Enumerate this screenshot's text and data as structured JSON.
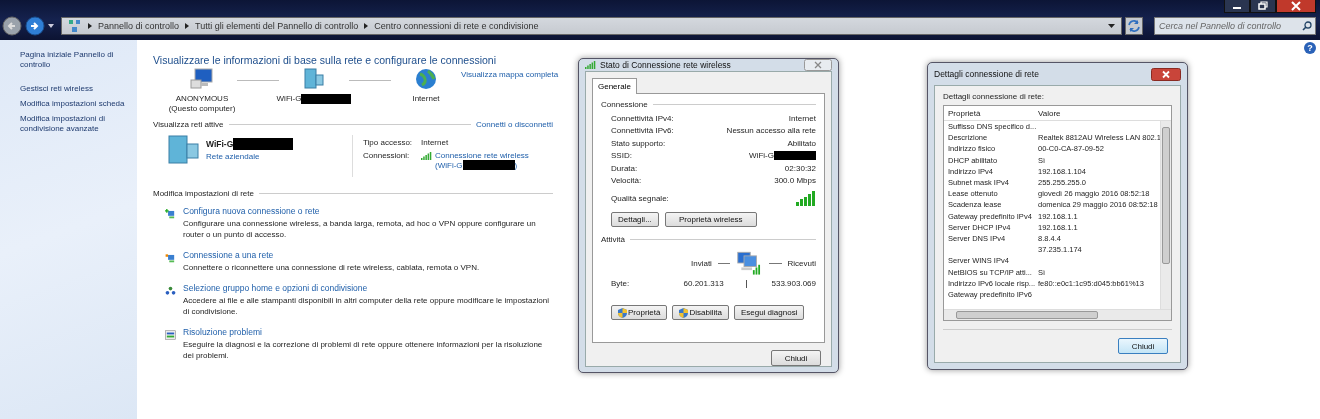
{
  "window": {
    "breadcrumb": [
      "Pannello di controllo",
      "Tutti gli elementi del Pannello di controllo",
      "Centro connessioni di rete e condivisione"
    ],
    "search": {
      "placeholder": "Cerca nel Pannello di controllo"
    },
    "help": "?"
  },
  "sidebar": {
    "items": [
      "Pagina iniziale Pannello di controllo",
      "Gestisci reti wireless",
      "Modifica impostazioni scheda",
      "Modifica impostazioni di condivisione avanzate"
    ]
  },
  "main": {
    "title": "Visualizzare le informazioni di base sulla rete e configurare le connessioni",
    "map_link": "Visualizza mappa completa",
    "map_nodes": [
      {
        "kind": "computer",
        "label": "ANONYMOUS",
        "sublabel": "(Questo computer)",
        "redacted": false
      },
      {
        "kind": "network",
        "label": "WiFi-G",
        "redacted": true
      },
      {
        "kind": "globe",
        "label": "Internet",
        "redacted": false
      }
    ],
    "active": {
      "heading": "Visualizza reti attive",
      "link": "Connetti o disconnetti",
      "name": "WiFi-G",
      "redacted": true,
      "type": "Rete aziendale",
      "access_label": "Tipo accesso:",
      "access_value": "Internet",
      "connections_label": "Connessioni:",
      "connection_link": "Connessione rete wireless",
      "connection_ssid": "(WiFi-G",
      "connection_ssid_end": ")"
    },
    "settings": {
      "heading": "Modifica impostazioni di rete",
      "tasks": [
        {
          "kind": "setup",
          "title": "Configura nuova connessione o rete",
          "description": "Configurare una connessione wireless, a banda larga, remota, ad hoc o VPN oppure configurare un router o un punto di accesso."
        },
        {
          "kind": "connect",
          "title": "Connessione a una rete",
          "description": "Connettere o riconnettere una connessione di rete wireless, cablata, remota o VPN."
        },
        {
          "kind": "homegroup",
          "title": "Selezione gruppo home e opzioni di condivisione",
          "description": "Accedere ai file e alle stampanti disponibili in altri computer della rete oppure modificare le impostazioni di condivisione."
        },
        {
          "kind": "troubleshoot",
          "title": "Risoluzione problemi",
          "description": "Eseguire la diagnosi e la correzione di problemi di rete oppure ottenere informazioni per la risoluzione dei problemi."
        }
      ]
    }
  },
  "status_dialog": {
    "title": "Stato di Connessione rete wireless",
    "tabs": [
      {
        "label": "Generale",
        "selected": true
      }
    ],
    "connection_heading": "Connessione",
    "rows": [
      {
        "label": "Connettività IPv4:",
        "value": "Internet",
        "redacted": false
      },
      {
        "label": "Connettività IPv6:",
        "value": "Nessun accesso alla rete",
        "redacted": false
      },
      {
        "label": "Stato supporto:",
        "value": "Abilitato",
        "redacted": false
      },
      {
        "label": "SSID:",
        "value": "WiFi-G",
        "redacted": true
      },
      {
        "label": "Durata:",
        "value": "02:30:32",
        "redacted": false
      },
      {
        "label": "Velocità:",
        "value": "300.0 Mbps",
        "redacted": false
      }
    ],
    "signal_label": "Qualità segnale:",
    "buttons": [
      "Dettagli...",
      "Proprietà wireless"
    ],
    "activity_heading": "Attività",
    "sent_label": "Inviati",
    "received_label": "Ricevuti",
    "bytes_label": "Byte:",
    "sent": "60.201.313",
    "received": "533.903.069",
    "actions": [
      {
        "label": "Proprietà",
        "shield": true
      },
      {
        "label": "Disabilita",
        "shield": true
      },
      {
        "label": "Esegui diagnosi",
        "shield": false
      }
    ],
    "close": "Chiudi"
  },
  "details_dialog": {
    "title": "Dettagli connessione di rete",
    "caption": "Dettagli connessione di rete:",
    "columns": [
      "Proprietà",
      "Valore"
    ],
    "rows": [
      {
        "property": "Suffisso DNS specifico d..."
      },
      {
        "property": "Descrizione",
        "value": "Realtek 8812AU Wireless LAN 802.1"
      },
      {
        "property": "Indirizzo fisico",
        "value": "00-C0-CA-87-09-52"
      },
      {
        "property": "DHCP abilitato",
        "value": "Sì"
      },
      {
        "property": "Indirizzo IPv4",
        "value": "192.168.1.104"
      },
      {
        "property": "Subnet mask IPv4",
        "value": "255.255.255.0"
      },
      {
        "property": "Lease ottenuto",
        "value": "giovedì 26 maggio 2016 08:52:18"
      },
      {
        "property": "Scadenza lease",
        "value": "domenica 29 maggio 2016 08:52:18"
      },
      {
        "property": "Gateway predefinito IPv4",
        "value": "192.168.1.1"
      },
      {
        "property": "Server DHCP IPv4",
        "value": "192.168.1.1"
      },
      {
        "property": "Server DNS IPv4",
        "value": "8.8.4.4"
      },
      {
        "value": "37.235.1.174"
      },
      {
        "property": "Server WINS IPv4"
      },
      {
        "property": "NetBIOS su TCP/IP atti...",
        "value": "Sì"
      },
      {
        "property": "Indirizzo IPv6 locale risp...",
        "value": "fe80::e0c1:1c95:d045:bb61%13"
      },
      {
        "property": "Gateway predefinito IPv6"
      }
    ],
    "close": "Chiudi"
  }
}
